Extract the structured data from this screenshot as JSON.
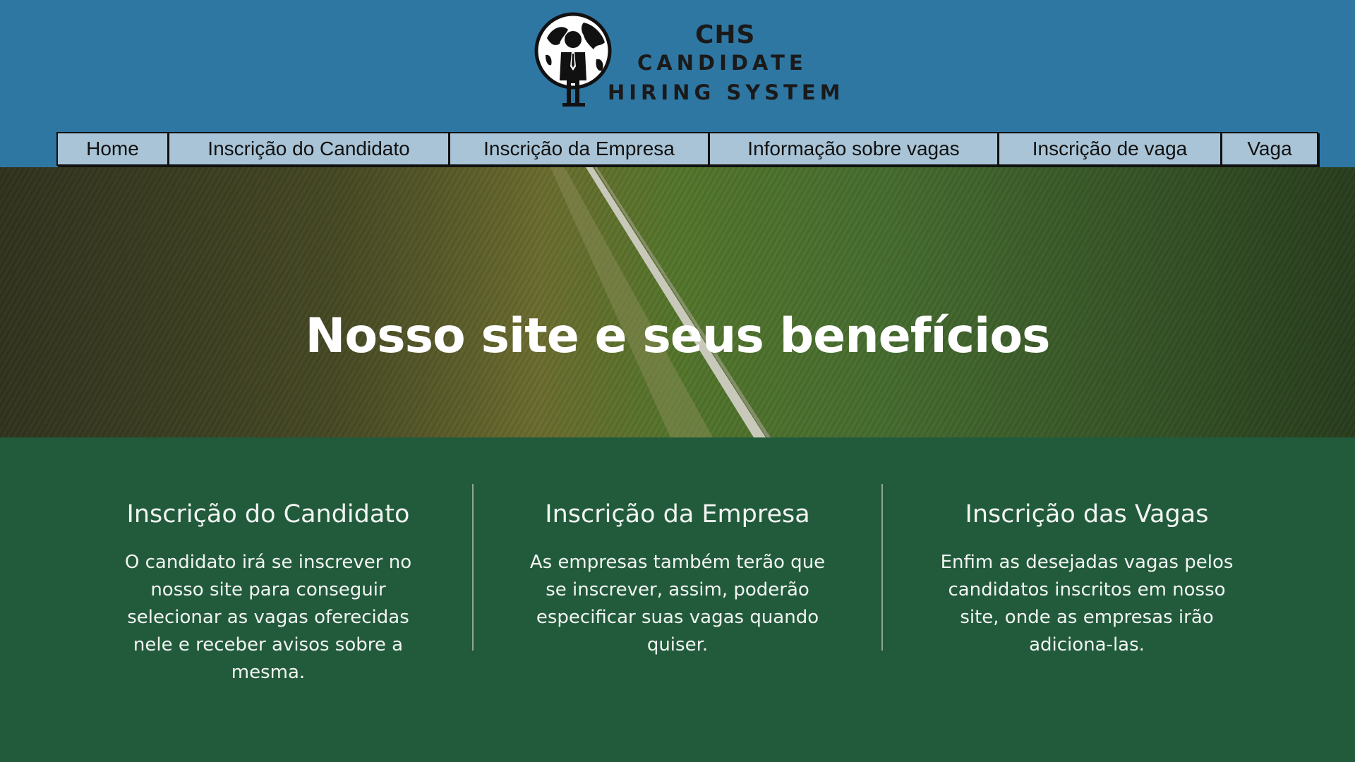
{
  "brand": {
    "mark": "CHS",
    "line1": "CANDIDATE",
    "line2": "HIRING SYSTEM",
    "logo_icon": "globe-businessman-icon"
  },
  "nav": {
    "items": [
      {
        "label": "Home"
      },
      {
        "label": "Inscrição do Candidato"
      },
      {
        "label": "Inscrição da Empresa"
      },
      {
        "label": "Informação sobre vagas"
      },
      {
        "label": "Inscrição de vaga"
      },
      {
        "label": "Vaga"
      }
    ]
  },
  "hero": {
    "title": "Nosso site e seus benefícios"
  },
  "features": [
    {
      "title": "Inscrição do Candidato",
      "text": "O candidato irá se inscrever no nosso site para conseguir selecionar as vagas oferecidas nele e receber avisos sobre a mesma."
    },
    {
      "title": "Inscrição da Empresa",
      "text": "As empresas também terão que se inscrever, assim, poderão especificar suas vagas quando quiser."
    },
    {
      "title": "Inscrição das Vagas",
      "text": "Enfim as desejadas vagas pelos candidatos inscritos em nosso site, onde as empresas irão adiciona-las."
    }
  ],
  "colors": {
    "header_bg": "#2f77a3",
    "nav_bg": "#a9c4d6",
    "features_bg": "#225b3c",
    "text_light": "#f1f4f1"
  }
}
